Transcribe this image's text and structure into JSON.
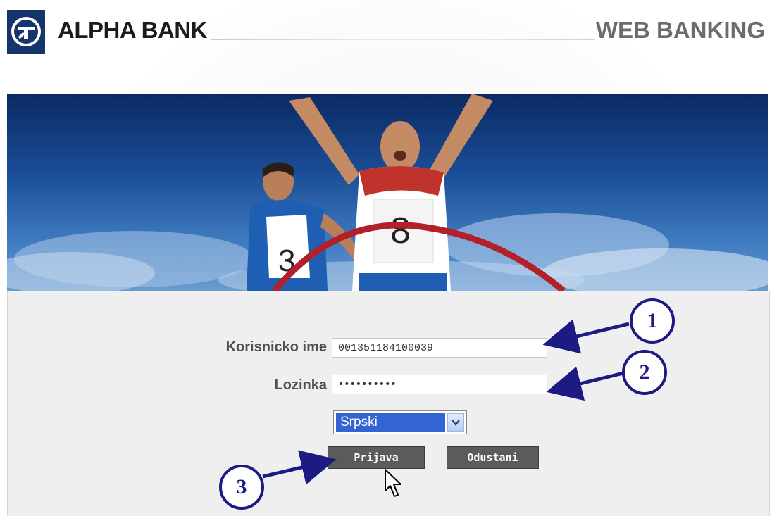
{
  "header": {
    "bank_name": "ALPHA BANK",
    "product_name": "WEB BANKING"
  },
  "hero": {
    "bib_left": "3",
    "bib_right": "8"
  },
  "login": {
    "username_label": "Korisnicko ime",
    "username_value": "001351184100039",
    "password_label": "Lozinka",
    "password_value": "••••••••••",
    "language_selected": "Srpski",
    "login_button": "Prijava",
    "cancel_button": "Odustani"
  },
  "annotations": {
    "step1": "1",
    "step2": "2",
    "step3": "3"
  },
  "colors": {
    "brand_navy": "#16356c",
    "callout_color": "#1e1a83",
    "button_gray": "#5b5b5b",
    "panel_gray": "#efefef",
    "select_highlight": "#3265d3"
  },
  "icons": {
    "logo": "alpha-logo-icon",
    "dropdown": "chevron-down-icon",
    "cursor": "mouse-pointer-icon"
  }
}
